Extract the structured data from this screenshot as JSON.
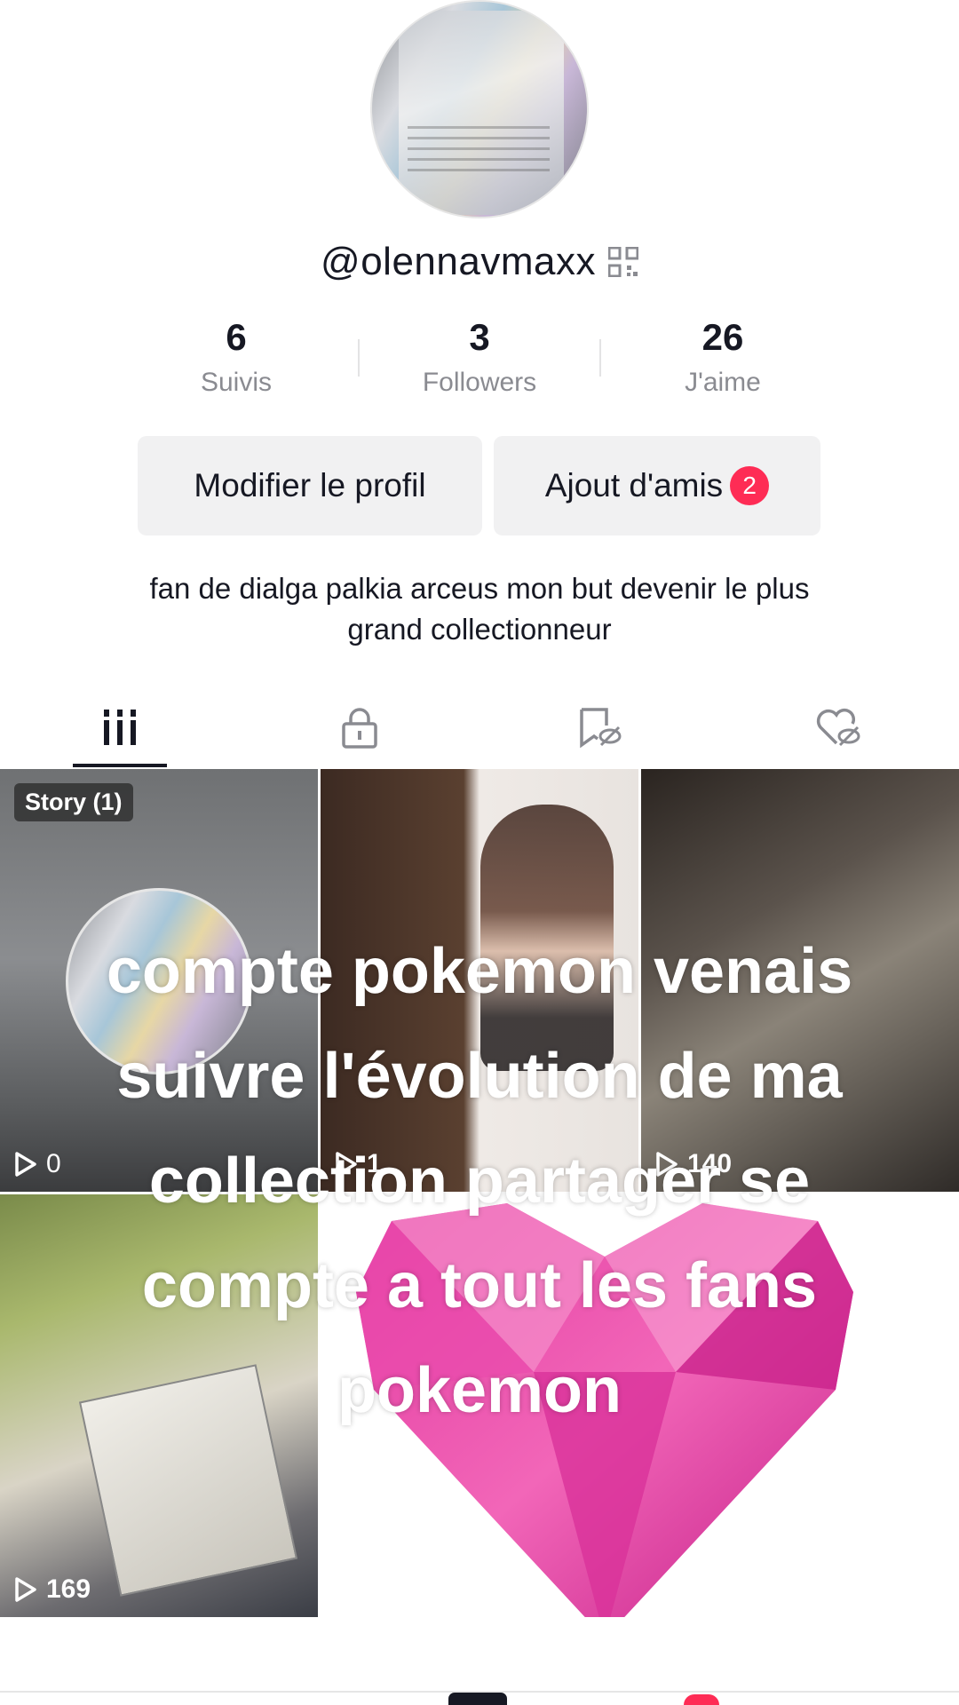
{
  "profile": {
    "username": "@olennavmaxx",
    "stats": [
      {
        "value": "6",
        "label": "Suivis"
      },
      {
        "value": "3",
        "label": "Followers"
      },
      {
        "value": "26",
        "label": "J'aime"
      }
    ],
    "edit_button": "Modifier le profil",
    "friends_button": "Ajout d'amis",
    "friends_badge": "2",
    "bio_line1": "fan de dialga palkia arceus mon but devenir le plus",
    "bio_line2": "grand collectionneur"
  },
  "tabs": [
    {
      "icon": "grid-icon",
      "selected": true
    },
    {
      "icon": "lock-icon",
      "selected": false
    },
    {
      "icon": "bookmark-hidden-icon",
      "selected": false
    },
    {
      "icon": "heart-hidden-icon",
      "selected": false
    }
  ],
  "videos": [
    {
      "badge": "Story (1)",
      "views": "0"
    },
    {
      "views": "1"
    },
    {
      "views": "140"
    },
    {
      "views": "169"
    },
    {
      "views": ""
    }
  ],
  "overlay_caption": {
    "line1": "compte pokemon venais",
    "line2": "suivre l'évolution de ma",
    "line3": "collection partager se",
    "line4": "compte a tout les fans",
    "line5": "pokemon"
  },
  "colors": {
    "accent": "#fe2c55",
    "text": "#161823",
    "muted": "#8a8b91",
    "button_bg": "#f1f1f2"
  }
}
